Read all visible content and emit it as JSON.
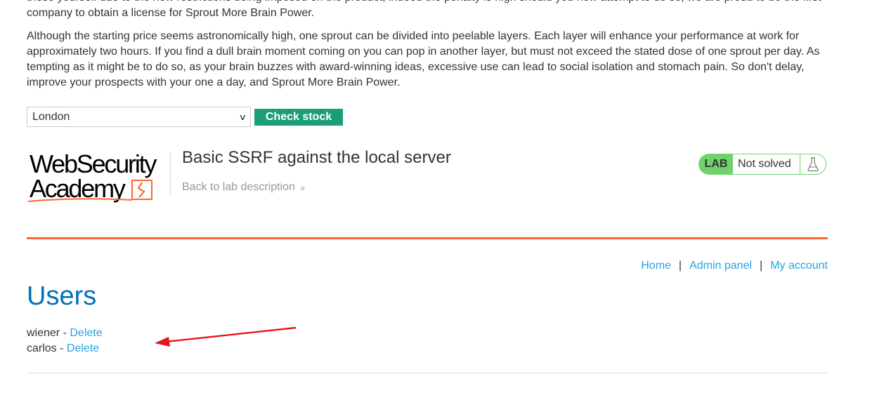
{
  "intro": {
    "paragraph1": "these yourself due to the new restrictions being imposed on the product, indeed the penalty is high should you now attempt to do so, we are proud to be the first company to obtain a license for Sprout More Brain Power.",
    "paragraph2": "Although the starting price seems astronomically high, one sprout can be divided into peelable layers. Each layer will enhance your performance at work for approximately two hours. If you find a dull brain moment coming on you can pop in another layer, but must not exceed the stated dose of one sprout per day. As tempting as it might be to do so, as your brain buzzes with award-winning ideas, excessive use can lead to social isolation and stomach pain. So don't delay, improve your prospects with your one a day, and Sprout More Brain Power."
  },
  "stock_form": {
    "selected_store": "London",
    "check_button": "Check stock"
  },
  "header": {
    "logo_line1": "WebSecurity",
    "logo_line2": "Academy",
    "lab_title": "Basic SSRF against the local server",
    "back_link": "Back to lab description",
    "back_arrow": "››",
    "lab_badge": "LAB",
    "lab_status": "Not solved",
    "flask_icon": "flask-icon"
  },
  "nav": {
    "home": "Home",
    "separator": "|",
    "admin_panel": "Admin panel",
    "my_account": "My account"
  },
  "users": {
    "heading": "Users",
    "list": [
      {
        "username": "wiener",
        "dash": " - ",
        "action": "Delete"
      },
      {
        "username": "carlos",
        "dash": " - ",
        "action": "Delete"
      }
    ]
  },
  "colors": {
    "accent_green": "#70d16d",
    "button_green": "#1b9e77",
    "link_blue": "#29a3e0",
    "heading_blue": "#0071bc",
    "rule_orange": "#ff6633",
    "annotation_red": "#e8141b"
  }
}
